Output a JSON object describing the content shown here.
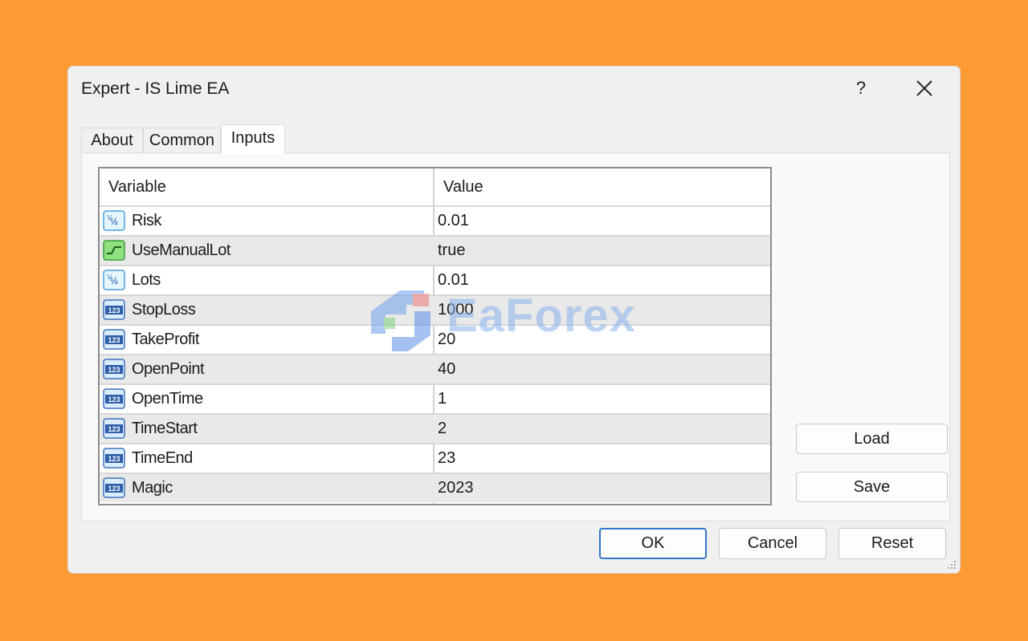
{
  "window": {
    "title": "Expert - IS Lime EA",
    "help_label": "?"
  },
  "tabs": [
    {
      "label": "About"
    },
    {
      "label": "Common"
    },
    {
      "label": "Inputs"
    }
  ],
  "grid": {
    "columns": [
      "Variable",
      "Value"
    ],
    "rows": [
      {
        "icon": "double-value-icon",
        "name": "Risk",
        "value": "0.01"
      },
      {
        "icon": "bool-value-icon",
        "name": "UseManualLot",
        "value": "true"
      },
      {
        "icon": "double-value-icon",
        "name": "Lots",
        "value": "0.01"
      },
      {
        "icon": "integer-value-icon",
        "name": "StopLoss",
        "value": "1000"
      },
      {
        "icon": "integer-value-icon",
        "name": "TakeProfit",
        "value": "20"
      },
      {
        "icon": "integer-value-icon",
        "name": "OpenPoint",
        "value": "40"
      },
      {
        "icon": "integer-value-icon",
        "name": "OpenTime",
        "value": "1"
      },
      {
        "icon": "integer-value-icon",
        "name": "TimeStart",
        "value": "2"
      },
      {
        "icon": "integer-value-icon",
        "name": "TimeEnd",
        "value": "23"
      },
      {
        "icon": "integer-value-icon",
        "name": "Magic",
        "value": "2023"
      }
    ]
  },
  "side_buttons": {
    "load": "Load",
    "save": "Save"
  },
  "footer": {
    "ok": "OK",
    "cancel": "Cancel",
    "reset": "Reset"
  },
  "watermark": {
    "text": "EaForex"
  },
  "colors": {
    "background": "#fd9a34",
    "dialog": "#f0f0f0",
    "default_button_border": "#2f76c9"
  }
}
